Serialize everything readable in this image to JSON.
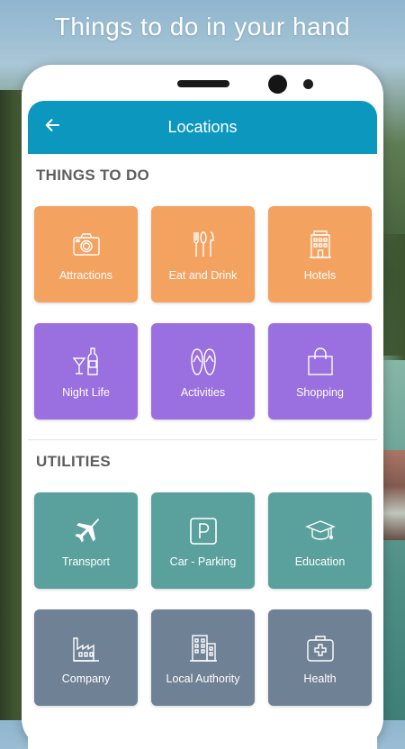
{
  "headline": "Things to do in your hand",
  "appbar": {
    "title": "Locations",
    "back_icon": "arrow-left-icon"
  },
  "colors": {
    "appbar": "#0c97bf",
    "orange": "#f3a260",
    "purple": "#9a6fe0",
    "teal": "#5aa19e",
    "slate": "#6f8194"
  },
  "sections": {
    "things_to_do": {
      "title": "THINGS TO DO",
      "tiles": [
        {
          "label": "Attractions",
          "icon": "camera-icon"
        },
        {
          "label": "Eat and Drink",
          "icon": "cutlery-icon"
        },
        {
          "label": "Hotels",
          "icon": "hotel-icon"
        },
        {
          "label": "Night Life",
          "icon": "cocktail-bottle-icon"
        },
        {
          "label": "Activities",
          "icon": "flip-flops-icon"
        },
        {
          "label": "Shopping",
          "icon": "shopping-bag-icon"
        }
      ]
    },
    "utilities": {
      "title": "UTILITIES",
      "tiles": [
        {
          "label": "Transport",
          "icon": "airplane-icon"
        },
        {
          "label": "Car - Parking",
          "icon": "parking-icon"
        },
        {
          "label": "Education",
          "icon": "graduation-cap-icon"
        },
        {
          "label": "Company",
          "icon": "factory-icon"
        },
        {
          "label": "Local Authority",
          "icon": "office-building-icon"
        },
        {
          "label": "Health",
          "icon": "first-aid-kit-icon"
        }
      ]
    }
  }
}
